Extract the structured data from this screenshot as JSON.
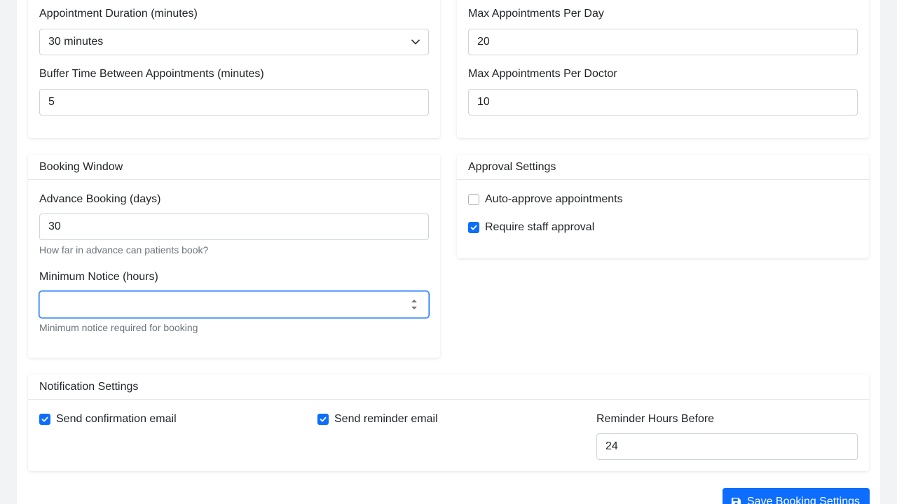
{
  "general": {
    "duration_label": "Appointment Duration (minutes)",
    "duration_value": "30 minutes",
    "buffer_label": "Buffer Time Between Appointments (minutes)",
    "buffer_value": "5",
    "max_day_label": "Max Appointments Per Day",
    "max_day_value": "20",
    "max_doctor_label": "Max Appointments Per Doctor",
    "max_doctor_value": "10"
  },
  "booking_window": {
    "title": "Booking Window",
    "advance_label": "Advance Booking (days)",
    "advance_value": "30",
    "advance_help": "How far in advance can patients book?",
    "notice_label": "Minimum Notice (hours)",
    "notice_value": "",
    "notice_help": "Minimum notice required for booking"
  },
  "approval": {
    "title": "Approval Settings",
    "auto_approve_label": "Auto-approve appointments",
    "auto_approve_checked": false,
    "staff_approval_label": "Require staff approval",
    "staff_approval_checked": true
  },
  "notifications": {
    "title": "Notification Settings",
    "confirmation_label": "Send confirmation email",
    "confirmation_checked": true,
    "reminder_label": "Send reminder email",
    "reminder_checked": true,
    "reminder_hours_label": "Reminder Hours Before",
    "reminder_hours_value": "24"
  },
  "actions": {
    "save_label": "Save Booking Settings",
    "save_icon": "floppy-disk-icon"
  },
  "colors": {
    "primary": "#0d6efd",
    "help_text": "#6c757d"
  }
}
